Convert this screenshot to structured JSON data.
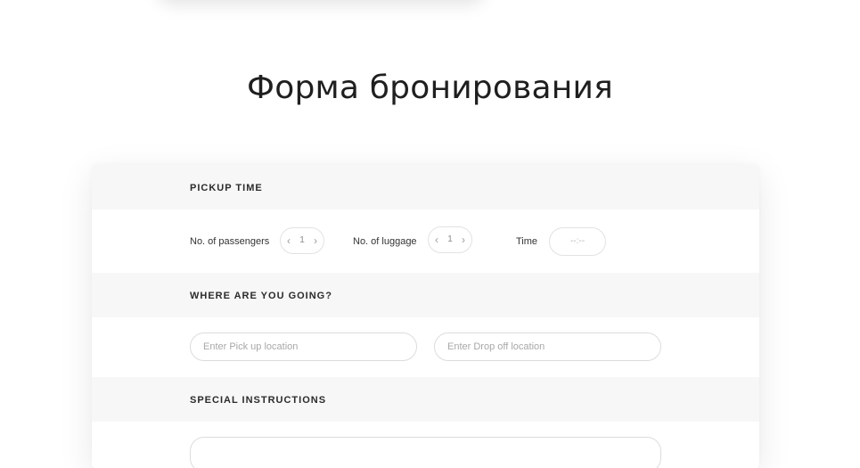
{
  "page": {
    "title": "Форма бронирования"
  },
  "sections": {
    "pickup_time": {
      "heading": "PICKUP TIME",
      "passengers_label": "No. of passengers",
      "passengers_value": "1",
      "luggage_label": "No. of luggage",
      "luggage_value": "1",
      "time_label": "Time",
      "time_value": "--:--"
    },
    "destination": {
      "heading": "WHERE ARE YOU GOING?",
      "pickup_placeholder": "Enter Pick up location",
      "dropoff_placeholder": "Enter Drop off location"
    },
    "special": {
      "heading": "SPECIAL INSTRUCTIONS"
    }
  },
  "icons": {
    "decrement": "chevron-left-icon",
    "increment": "chevron-right-icon"
  },
  "colors": {
    "section_header_bg": "#f7f7f7",
    "field_border": "#e2e2e2",
    "placeholder": "#a8a8a8"
  }
}
